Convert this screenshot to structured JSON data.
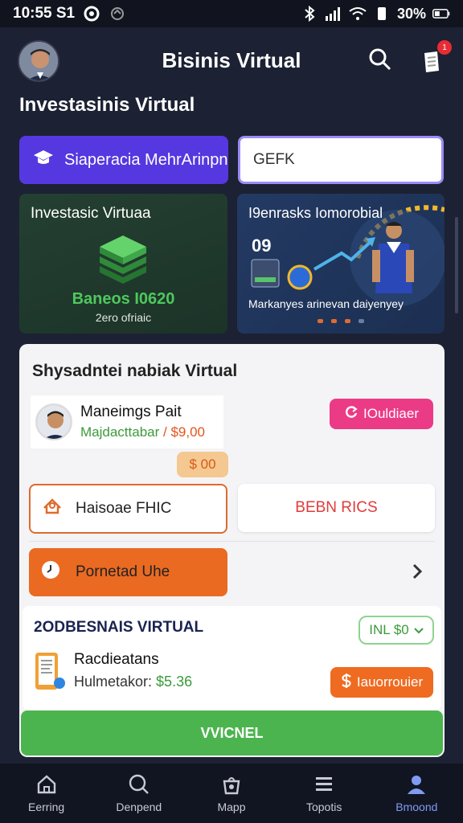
{
  "status_bar": {
    "time": "10:55 S1",
    "battery": "30%"
  },
  "header": {
    "title": "Bisinis Virtual",
    "notification_count": "1"
  },
  "section_title": "Investasinis Virtual",
  "primary_button": {
    "label": "Siaperacia MehrArinpn"
  },
  "input": {
    "value": "GEFK"
  },
  "card_green": {
    "title": "Investasic Virtuaa",
    "balance": "Baneos I0620",
    "subtitle": "2ero ofriaic"
  },
  "card_blue": {
    "title": "I9enrasks Iomorobial",
    "number": "09",
    "description": "Markanyes arinevan daiyenyey"
  },
  "panel": {
    "title": "Shysadntei nabiak Virtual",
    "profile_name": "Maneimgs Pait",
    "profile_label": "Majdacttabar",
    "profile_price": "$9,00",
    "pink_button": "IOuldiaer",
    "price_chip": "$ 00",
    "outline_button": "Haisoae FHIC",
    "white_button": "BEBN RICS",
    "orange_button": "Pornetad Uhe",
    "sub_card": {
      "title": "2ODBESNAIS VIRTUAL",
      "select": "INL $0",
      "item_name": "Racdieatans",
      "item_label": "Hulmetakor:",
      "item_price": "$5.36",
      "action": "Iauorrouier"
    },
    "green_button": "VVICNEL"
  },
  "bottom_nav": [
    {
      "label": "Eerring",
      "icon": "home-icon"
    },
    {
      "label": "Denpend",
      "icon": "search-icon"
    },
    {
      "label": "Mapp",
      "icon": "bag-icon"
    },
    {
      "label": "Topotis",
      "icon": "menu-icon"
    },
    {
      "label": "Bmoond",
      "icon": "user-icon"
    }
  ],
  "colors": {
    "accent_purple": "#5538e0",
    "accent_pink": "#ec3b86",
    "accent_orange": "#ea6a22",
    "accent_green": "#4cb44f"
  }
}
